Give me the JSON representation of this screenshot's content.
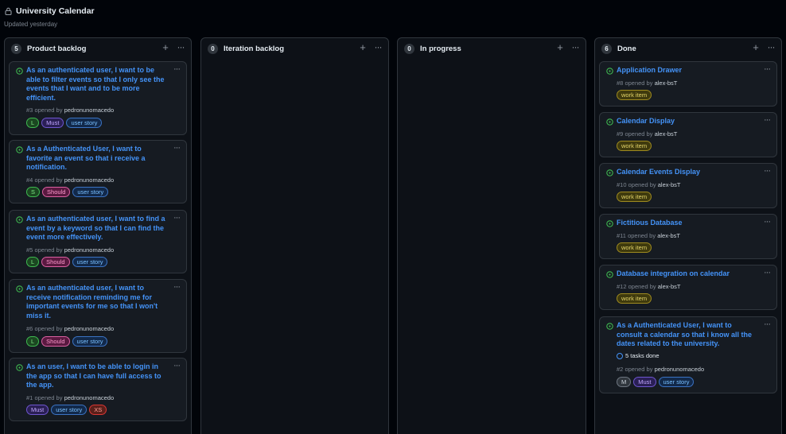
{
  "header": {
    "title": "University Calendar",
    "subtitle": "Updated yesterday",
    "icon": "lock-icon"
  },
  "colors": {
    "open_issue": "#3fb950",
    "link": "#4493f8",
    "background": "#010409",
    "column": "#0d1117"
  },
  "label_styles": {
    "L": {
      "fg": "#7ee787",
      "bg": "#1b4721",
      "bd": "#3fb950"
    },
    "S": {
      "fg": "#7ee787",
      "bg": "#1b4721",
      "bd": "#3fb950"
    },
    "M": {
      "fg": "#c9d1d9",
      "bg": "#30363d",
      "bd": "#6e7681"
    },
    "Must": {
      "fg": "#c0a6ff",
      "bg": "#2a1f55",
      "bd": "#6e56cf"
    },
    "Should": {
      "fg": "#ff9bce",
      "bg": "#5a1940",
      "bd": "#db61a2"
    },
    "user story": {
      "fg": "#79c0ff",
      "bg": "#12294a",
      "bd": "#3b73c4"
    },
    "XS": {
      "fg": "#ffa198",
      "bg": "#5a1f1a",
      "bd": "#da3633"
    },
    "work item": {
      "fg": "#e3d46a",
      "bg": "#3f3a0d",
      "bd": "#9e8a1f"
    }
  },
  "columns": [
    {
      "title": "Product backlog",
      "count": "5",
      "cards": [
        {
          "title": "As an authenticated user, I want to be able to filter events so that I only see the events that I want and to be more efficient.",
          "number": "#3",
          "opened_by": "opened by",
          "author": "pedronunomacedo",
          "labels": [
            "L",
            "Must",
            "user story"
          ]
        },
        {
          "title": "As a Authenticated User, I want to favorite an event so that i receive a notification.",
          "number": "#4",
          "opened_by": "opened by",
          "author": "pedronunomacedo",
          "labels": [
            "S",
            "Should",
            "user story"
          ]
        },
        {
          "title": "As an authenticated user, I want to find a event by a keyword so that I can find the event more effectively.",
          "number": "#5",
          "opened_by": "opened by",
          "author": "pedronunomacedo",
          "labels": [
            "L",
            "Should",
            "user story"
          ]
        },
        {
          "title": "As an authenticated user, I want to receive notification reminding me for important events for me so that I won't miss it.",
          "number": "#6",
          "opened_by": "opened by",
          "author": "pedronunomacedo",
          "labels": [
            "L",
            "Should",
            "user story"
          ]
        },
        {
          "title": "As an user, I want to be able to login in the app so that I can have full access to the app.",
          "number": "#1",
          "opened_by": "opened by",
          "author": "pedronunomacedo",
          "labels": [
            "Must",
            "user story",
            "XS"
          ]
        }
      ]
    },
    {
      "title": "Iteration backlog",
      "count": "0",
      "cards": []
    },
    {
      "title": "In progress",
      "count": "0",
      "cards": []
    },
    {
      "title": "Done",
      "count": "6",
      "cards": [
        {
          "title": "Application Drawer",
          "number": "#8",
          "opened_by": "opened by",
          "author": "alex-bsT",
          "labels": [
            "work item"
          ]
        },
        {
          "title": "Calendar Display",
          "number": "#9",
          "opened_by": "opened by",
          "author": "alex-bsT",
          "labels": [
            "work item"
          ]
        },
        {
          "title": "Calendar Events Display",
          "number": "#10",
          "opened_by": "opened by",
          "author": "alex-bsT",
          "labels": [
            "work item"
          ]
        },
        {
          "title": "Fictitious Database",
          "number": "#11",
          "opened_by": "opened by",
          "author": "alex-bsT",
          "labels": [
            "work item"
          ]
        },
        {
          "title": "Database integration on calendar",
          "number": "#12",
          "opened_by": "opened by",
          "author": "alex-bsT",
          "labels": [
            "work item"
          ]
        },
        {
          "title": "As a Authenticated User, I want to consult a calendar so that i know all the dates related to the university.",
          "tasks": "5 tasks done",
          "number": "#2",
          "opened_by": "opened by",
          "author": "pedronunomacedo",
          "labels": [
            "M",
            "Must",
            "user story"
          ]
        }
      ]
    }
  ]
}
